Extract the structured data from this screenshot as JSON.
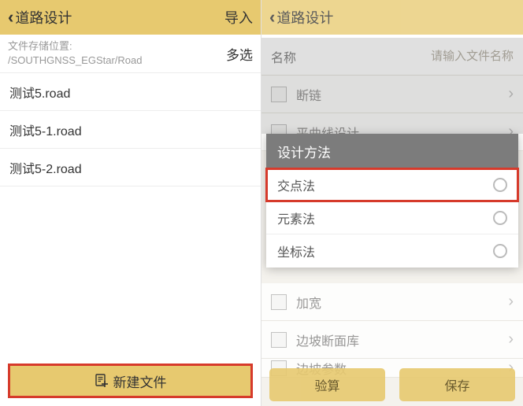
{
  "left": {
    "back_chevron": "‹",
    "title": "道路设计",
    "import_action": "导入",
    "storage_label": "文件存储位置:",
    "storage_path": "/SOUTHGNSS_EGStar/Road",
    "multi_select": "多选",
    "files": [
      {
        "name": "测试5.road"
      },
      {
        "name": "测试5-1.road"
      },
      {
        "name": "测试5-2.road"
      }
    ],
    "new_file_label": "新建文件"
  },
  "right": {
    "back_chevron": "‹",
    "title": "道路设计",
    "name_label": "名称",
    "name_placeholder": "请输入文件名称",
    "settings": [
      {
        "label": "断链"
      },
      {
        "label": "平曲线设计"
      },
      {
        "label": "加宽"
      },
      {
        "label": "边坡断面库"
      },
      {
        "label": "边坡参数"
      }
    ],
    "verify_label": "验算",
    "save_label": "保存",
    "modal": {
      "title": "设计方法",
      "options": [
        {
          "label": "交点法",
          "highlight": true
        },
        {
          "label": "元素法",
          "highlight": false
        },
        {
          "label": "坐标法",
          "highlight": false
        }
      ]
    }
  }
}
